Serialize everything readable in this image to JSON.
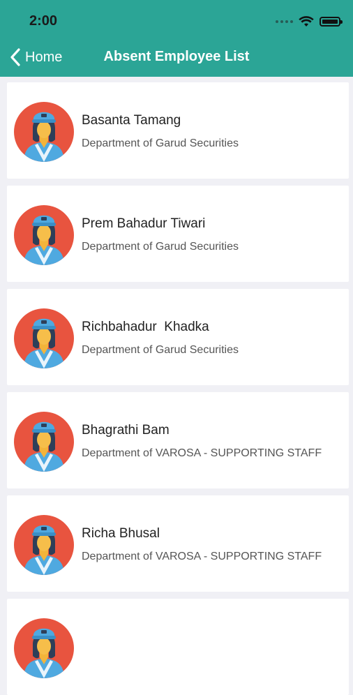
{
  "status_bar": {
    "time": "2:00",
    "icons": [
      "signal-icon",
      "wifi-icon",
      "battery-icon"
    ]
  },
  "nav": {
    "back_label": "Home",
    "title": "Absent Employee List"
  },
  "colors": {
    "header": "#2ba596",
    "avatar_bg": "#e8543f",
    "avatar_uniform": "#4fa9e0"
  },
  "employees": [
    {
      "name": "Basanta Tamang",
      "department": "Department of Garud Securities"
    },
    {
      "name": "Prem Bahadur Tiwari",
      "department": "Department of Garud Securities"
    },
    {
      "name": "Richbahadur  Khadka",
      "department": "Department of Garud Securities"
    },
    {
      "name": "Bhagrathi Bam",
      "department": "Department of VAROSA - SUPPORTING STAFF"
    },
    {
      "name": "Richa Bhusal",
      "department": "Department of VAROSA - SUPPORTING STAFF"
    },
    {
      "name": "",
      "department": ""
    }
  ]
}
